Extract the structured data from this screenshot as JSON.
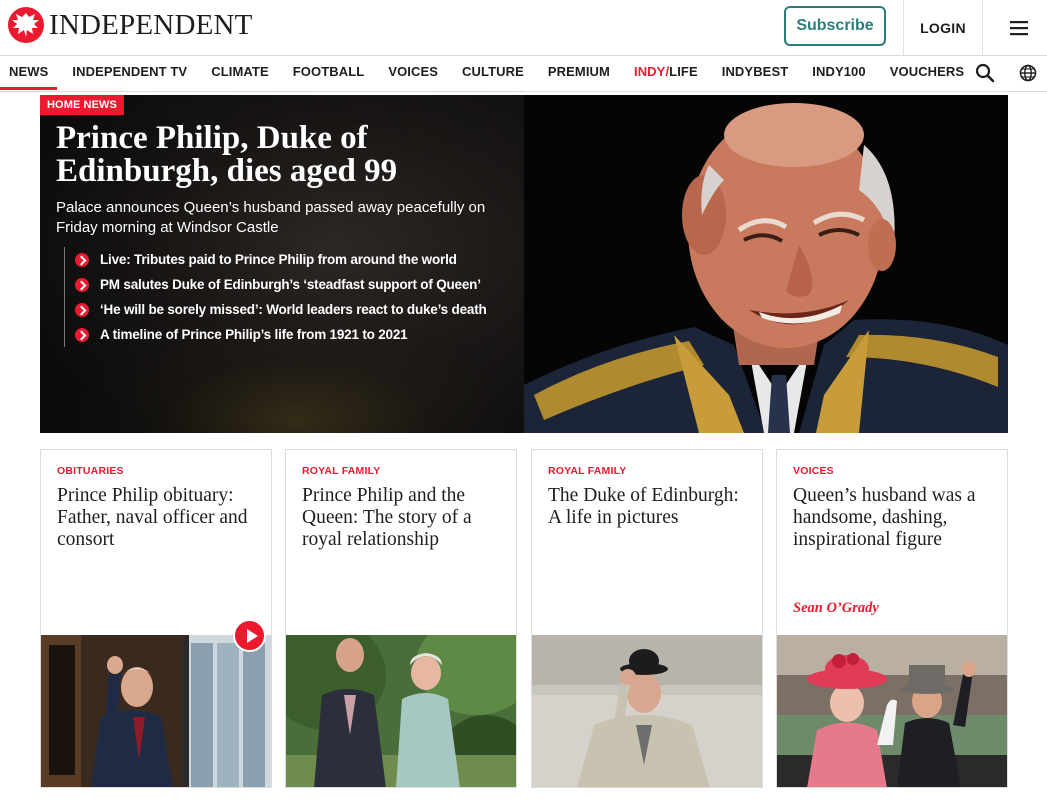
{
  "header": {
    "brand": "INDEPENDENT",
    "subscribe_label": "Subscribe",
    "login_label": "LOGIN",
    "accent_color": "#ec1a2e",
    "subscribe_color": "#2c7c7c"
  },
  "nav": {
    "items": [
      {
        "label": "NEWS",
        "active": true
      },
      {
        "label": "INDEPENDENT TV"
      },
      {
        "label": "CLIMATE"
      },
      {
        "label": "FOOTBALL"
      },
      {
        "label": "VOICES"
      },
      {
        "label": "CULTURE"
      },
      {
        "label": "PREMIUM"
      },
      {
        "label_prefix": "INDY/",
        "label": "LIFE"
      },
      {
        "label": "INDYBEST"
      },
      {
        "label": "INDY100"
      },
      {
        "label": "VOUCHERS"
      }
    ],
    "icons": [
      "search-icon",
      "globe-icon"
    ]
  },
  "hero": {
    "badge": "HOME NEWS",
    "title": "Prince Philip, Duke of Edinburgh, dies aged 99",
    "standfirst": "Palace announces Queen’s husband passed away peacefully on Friday morning at Windsor Castle",
    "links": [
      "Live: Tributes paid to Prince Philip from around the world",
      "PM salutes Duke of Edinburgh’s ‘steadfast support of Queen’",
      "‘He will be sorely missed’: World leaders react to duke’s death",
      "A timeline of Prince Philip’s life from 1921 to 2021"
    ]
  },
  "cards": [
    {
      "kicker": "OBITUARIES",
      "title": "Prince Philip obituary: Father, naval officer and consort",
      "has_video": true
    },
    {
      "kicker": "ROYAL FAMILY",
      "title": "Prince Philip and the Queen: The story of a royal relationship"
    },
    {
      "kicker": "ROYAL FAMILY",
      "title": "The Duke of Edinburgh: A life in pictures"
    },
    {
      "kicker": "VOICES",
      "title": "Queen’s husband was a handsome, dashing, inspirational figure",
      "author": "Sean O’Grady"
    }
  ]
}
